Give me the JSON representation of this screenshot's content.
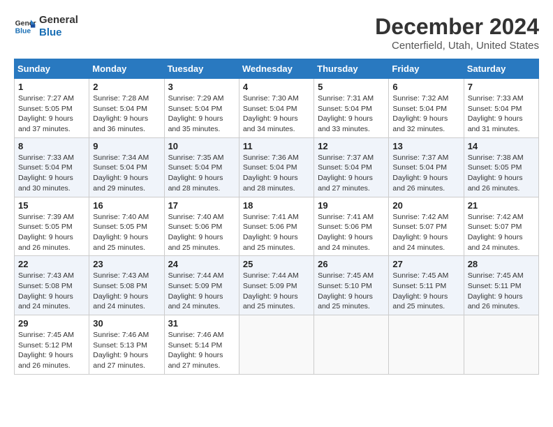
{
  "header": {
    "logo_line1": "General",
    "logo_line2": "Blue",
    "month": "December 2024",
    "location": "Centerfield, Utah, United States"
  },
  "weekdays": [
    "Sunday",
    "Monday",
    "Tuesday",
    "Wednesday",
    "Thursday",
    "Friday",
    "Saturday"
  ],
  "weeks": [
    [
      {
        "day": "1",
        "sunrise": "7:27 AM",
        "sunset": "5:05 PM",
        "daylight": "9 hours and 37 minutes."
      },
      {
        "day": "2",
        "sunrise": "7:28 AM",
        "sunset": "5:04 PM",
        "daylight": "9 hours and 36 minutes."
      },
      {
        "day": "3",
        "sunrise": "7:29 AM",
        "sunset": "5:04 PM",
        "daylight": "9 hours and 35 minutes."
      },
      {
        "day": "4",
        "sunrise": "7:30 AM",
        "sunset": "5:04 PM",
        "daylight": "9 hours and 34 minutes."
      },
      {
        "day": "5",
        "sunrise": "7:31 AM",
        "sunset": "5:04 PM",
        "daylight": "9 hours and 33 minutes."
      },
      {
        "day": "6",
        "sunrise": "7:32 AM",
        "sunset": "5:04 PM",
        "daylight": "9 hours and 32 minutes."
      },
      {
        "day": "7",
        "sunrise": "7:33 AM",
        "sunset": "5:04 PM",
        "daylight": "9 hours and 31 minutes."
      }
    ],
    [
      {
        "day": "8",
        "sunrise": "7:33 AM",
        "sunset": "5:04 PM",
        "daylight": "9 hours and 30 minutes."
      },
      {
        "day": "9",
        "sunrise": "7:34 AM",
        "sunset": "5:04 PM",
        "daylight": "9 hours and 29 minutes."
      },
      {
        "day": "10",
        "sunrise": "7:35 AM",
        "sunset": "5:04 PM",
        "daylight": "9 hours and 28 minutes."
      },
      {
        "day": "11",
        "sunrise": "7:36 AM",
        "sunset": "5:04 PM",
        "daylight": "9 hours and 28 minutes."
      },
      {
        "day": "12",
        "sunrise": "7:37 AM",
        "sunset": "5:04 PM",
        "daylight": "9 hours and 27 minutes."
      },
      {
        "day": "13",
        "sunrise": "7:37 AM",
        "sunset": "5:04 PM",
        "daylight": "9 hours and 26 minutes."
      },
      {
        "day": "14",
        "sunrise": "7:38 AM",
        "sunset": "5:05 PM",
        "daylight": "9 hours and 26 minutes."
      }
    ],
    [
      {
        "day": "15",
        "sunrise": "7:39 AM",
        "sunset": "5:05 PM",
        "daylight": "9 hours and 26 minutes."
      },
      {
        "day": "16",
        "sunrise": "7:40 AM",
        "sunset": "5:05 PM",
        "daylight": "9 hours and 25 minutes."
      },
      {
        "day": "17",
        "sunrise": "7:40 AM",
        "sunset": "5:06 PM",
        "daylight": "9 hours and 25 minutes."
      },
      {
        "day": "18",
        "sunrise": "7:41 AM",
        "sunset": "5:06 PM",
        "daylight": "9 hours and 25 minutes."
      },
      {
        "day": "19",
        "sunrise": "7:41 AM",
        "sunset": "5:06 PM",
        "daylight": "9 hours and 24 minutes."
      },
      {
        "day": "20",
        "sunrise": "7:42 AM",
        "sunset": "5:07 PM",
        "daylight": "9 hours and 24 minutes."
      },
      {
        "day": "21",
        "sunrise": "7:42 AM",
        "sunset": "5:07 PM",
        "daylight": "9 hours and 24 minutes."
      }
    ],
    [
      {
        "day": "22",
        "sunrise": "7:43 AM",
        "sunset": "5:08 PM",
        "daylight": "9 hours and 24 minutes."
      },
      {
        "day": "23",
        "sunrise": "7:43 AM",
        "sunset": "5:08 PM",
        "daylight": "9 hours and 24 minutes."
      },
      {
        "day": "24",
        "sunrise": "7:44 AM",
        "sunset": "5:09 PM",
        "daylight": "9 hours and 24 minutes."
      },
      {
        "day": "25",
        "sunrise": "7:44 AM",
        "sunset": "5:09 PM",
        "daylight": "9 hours and 25 minutes."
      },
      {
        "day": "26",
        "sunrise": "7:45 AM",
        "sunset": "5:10 PM",
        "daylight": "9 hours and 25 minutes."
      },
      {
        "day": "27",
        "sunrise": "7:45 AM",
        "sunset": "5:11 PM",
        "daylight": "9 hours and 25 minutes."
      },
      {
        "day": "28",
        "sunrise": "7:45 AM",
        "sunset": "5:11 PM",
        "daylight": "9 hours and 26 minutes."
      }
    ],
    [
      {
        "day": "29",
        "sunrise": "7:45 AM",
        "sunset": "5:12 PM",
        "daylight": "9 hours and 26 minutes."
      },
      {
        "day": "30",
        "sunrise": "7:46 AM",
        "sunset": "5:13 PM",
        "daylight": "9 hours and 27 minutes."
      },
      {
        "day": "31",
        "sunrise": "7:46 AM",
        "sunset": "5:14 PM",
        "daylight": "9 hours and 27 minutes."
      },
      null,
      null,
      null,
      null
    ]
  ]
}
